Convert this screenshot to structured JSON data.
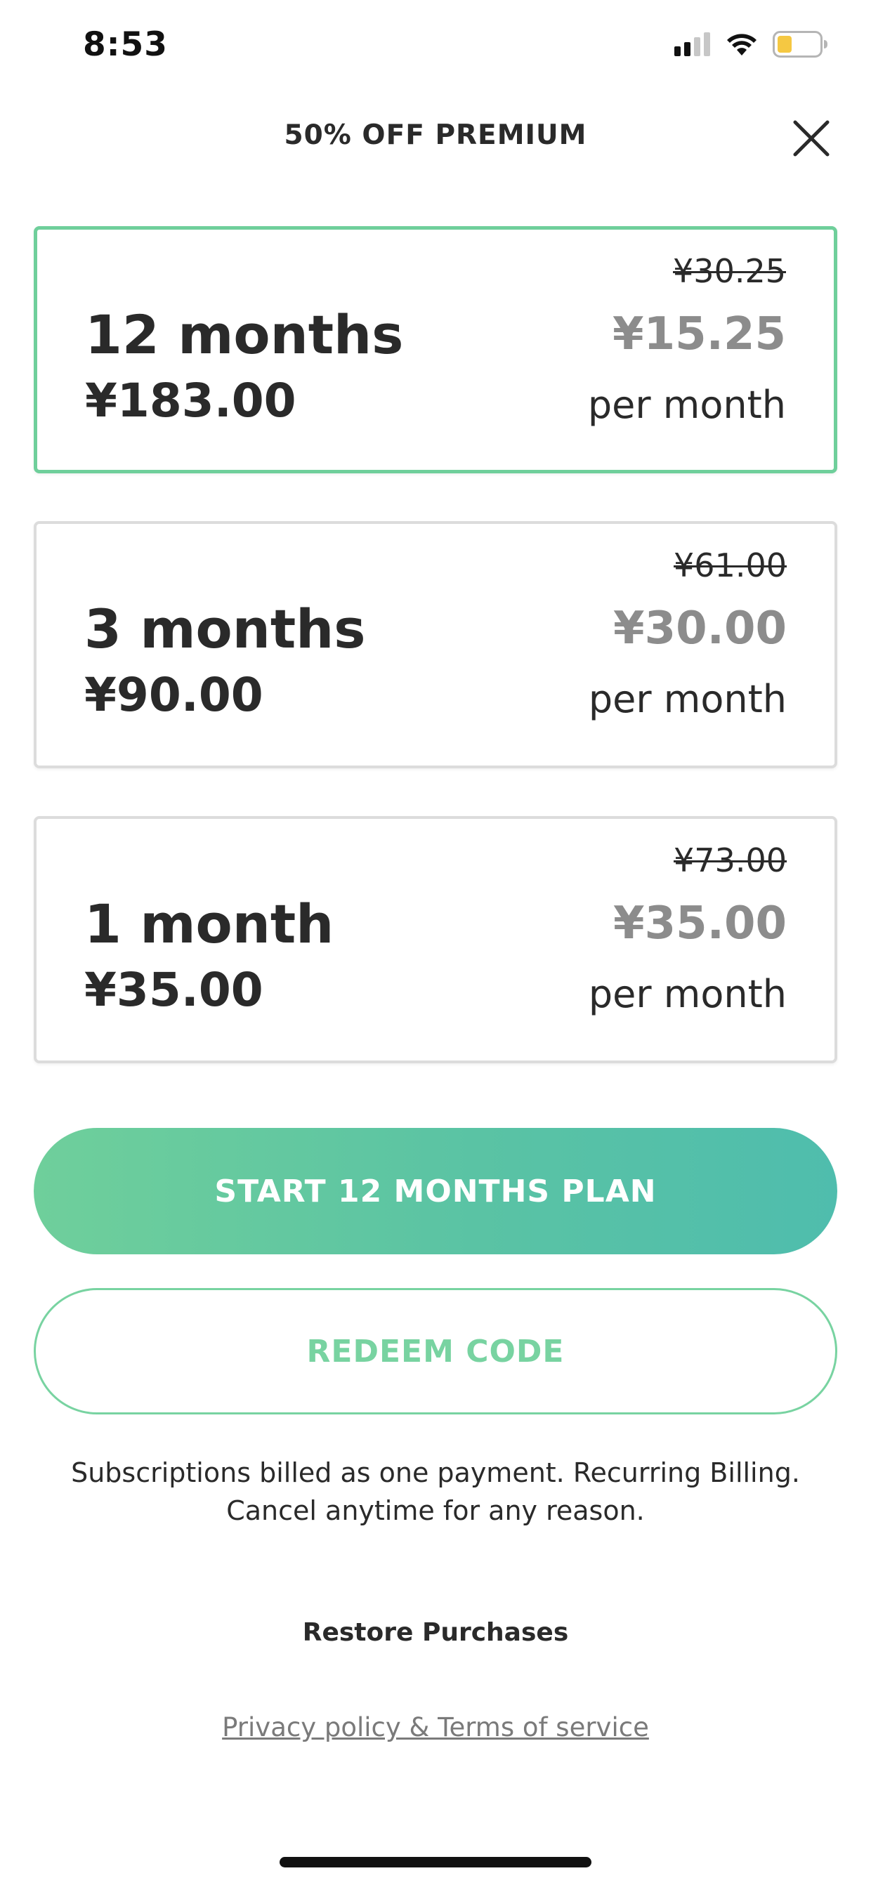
{
  "status_bar": {
    "time": "8:53",
    "icons": [
      "cellular-signal-icon",
      "wifi-icon",
      "battery-icon"
    ],
    "battery_color": "#f5c842"
  },
  "header": {
    "title": "50% OFF PREMIUM",
    "close_icon": "close-icon"
  },
  "plans": [
    {
      "duration": "12 months",
      "total": "¥183.00",
      "original_monthly": "¥30.25",
      "monthly": "¥15.25",
      "per_month": "per month",
      "selected": true
    },
    {
      "duration": "3 months",
      "total": "¥90.00",
      "original_monthly": "¥61.00",
      "monthly": "¥30.00",
      "per_month": "per month",
      "selected": false
    },
    {
      "duration": "1 month",
      "total": "¥35.00",
      "original_monthly": "¥73.00",
      "monthly": "¥35.00",
      "per_month": "per month",
      "selected": false
    }
  ],
  "buttons": {
    "start": "START 12 MONTHS PLAN",
    "redeem": "REDEEM CODE"
  },
  "disclaimer": {
    "line1": "Subscriptions billed as one payment. Recurring Billing.",
    "line2": "Cancel anytime for any reason."
  },
  "links": {
    "restore": "Restore Purchases",
    "privacy": "Privacy policy & Terms of service"
  },
  "colors": {
    "accent": "#6fcf9b",
    "accent_end": "#4fbdad",
    "selected_border": "#6fcf9b",
    "discount_price": "#8c8c8c"
  }
}
